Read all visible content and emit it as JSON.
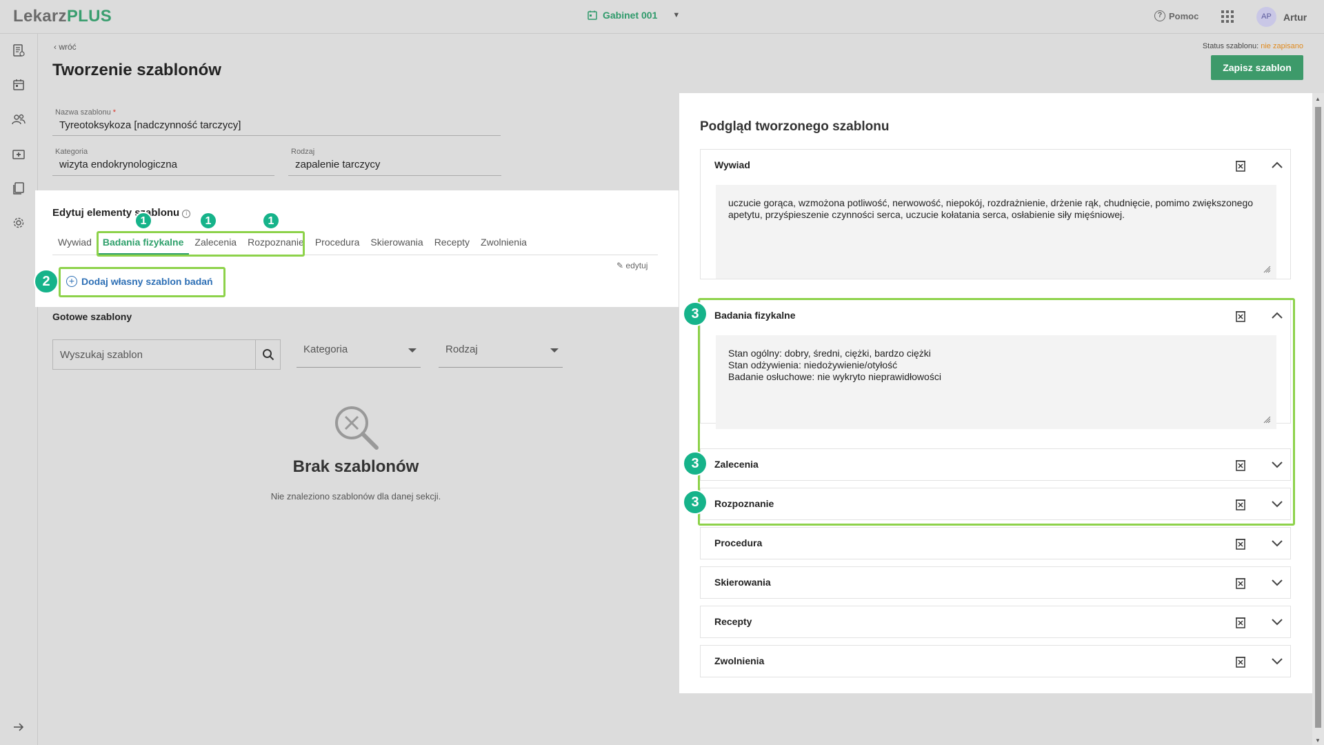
{
  "header": {
    "logo_main": "Lekarz",
    "logo_accent": "PLUS",
    "gabinet": "Gabinet 001",
    "help": "Pomoc",
    "avatar_initials": "AP",
    "user_name": "Artur"
  },
  "page": {
    "back": "wróć",
    "title": "Tworzenie szablonów",
    "status_label": "Status szablonu:",
    "status_value": "nie zapisano",
    "save_button": "Zapisz szablon"
  },
  "form": {
    "name_label": "Nazwa szablonu",
    "name_required": "*",
    "name_value": "Tyreotoksykoza [nadczynność tarczycy]",
    "category_label": "Kategoria",
    "category_value": "wizyta endokrynologiczna",
    "type_label": "Rodzaj",
    "type_value": "zapalenie tarczycy"
  },
  "editor": {
    "title": "Edytuj elementy szablonu",
    "tabs": [
      "Wywiad",
      "Badania fizykalne",
      "Zalecenia",
      "Rozpoznanie",
      "Procedura",
      "Skierowania",
      "Recepty",
      "Zwolnienia"
    ],
    "active_tab": "Badania fizykalne",
    "edit_link": "edytuj",
    "add_button": "Dodaj własny szablon badań"
  },
  "ready": {
    "title": "Gotowe szablony",
    "search_placeholder": "Wyszukaj szablon",
    "category_select": "Kategoria",
    "type_select": "Rodzaj",
    "empty_title": "Brak szablonów",
    "empty_subtitle": "Nie znaleziono szablonów dla danej sekcji."
  },
  "preview": {
    "title": "Podgląd tworzonego szablonu",
    "sections": [
      {
        "name": "Wywiad",
        "expanded": true,
        "text": "uczucie gorąca, wzmożona potliwość, nerwowość, niepokój, rozdrażnienie, drżenie rąk, chudnięcie, pomimo zwiększonego apetytu, przyśpieszenie czynności serca, uczucie kołatania serca, osłabienie siły mięśniowej."
      },
      {
        "name": "Badania fizykalne",
        "expanded": true,
        "text": "Stan ogólny: dobry, średni, ciężki, bardzo ciężki\nStan odżywienia: niedożywienie/otyłość\nBadanie osłuchowe: nie wykryto nieprawidłowości"
      },
      {
        "name": "Zalecenia",
        "expanded": false
      },
      {
        "name": "Rozpoznanie",
        "expanded": false
      },
      {
        "name": "Procedura",
        "expanded": false
      },
      {
        "name": "Skierowania",
        "expanded": false
      },
      {
        "name": "Recepty",
        "expanded": false
      },
      {
        "name": "Zwolnienia",
        "expanded": false
      }
    ]
  },
  "annotations": {
    "badge1": "1",
    "badge2": "2",
    "badge3": "3"
  },
  "colors": {
    "accent_green": "#2fa06b",
    "highlight": "#8dd24a",
    "badge": "#16b38a",
    "status_warning": "#e08a1e"
  }
}
